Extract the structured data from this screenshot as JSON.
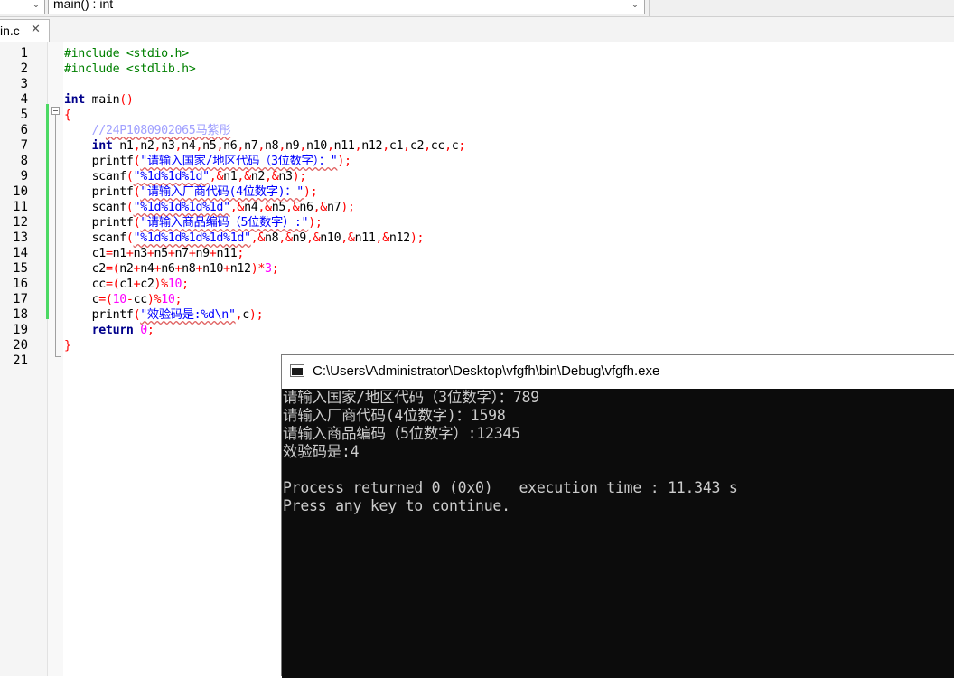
{
  "toolbar": {
    "scope_combo_value": "",
    "function_combo_value": "main() : int"
  },
  "tab": {
    "filename": "in.c",
    "close_glyph": "✕"
  },
  "editor": {
    "lines": [
      {
        "num": "1",
        "tokens": [
          {
            "t": "#include <stdio.h>",
            "c": "pre"
          }
        ]
      },
      {
        "num": "2",
        "tokens": [
          {
            "t": "#include <stdlib.h>",
            "c": "pre"
          }
        ]
      },
      {
        "num": "3",
        "tokens": []
      },
      {
        "num": "4",
        "tokens": [
          {
            "t": "int",
            "c": "kw"
          },
          {
            "t": " main",
            "c": ""
          },
          {
            "t": "()",
            "c": "pun"
          }
        ]
      },
      {
        "num": "5",
        "tokens": [
          {
            "t": "{",
            "c": "pun"
          }
        ]
      },
      {
        "num": "6",
        "tokens": [
          {
            "t": "    ",
            "c": ""
          },
          {
            "t": "//",
            "c": "cmt"
          },
          {
            "t": "24P1080902065马紫彤",
            "c": "cmt sq"
          }
        ]
      },
      {
        "num": "7",
        "tokens": [
          {
            "t": "    ",
            "c": ""
          },
          {
            "t": "int",
            "c": "kw"
          },
          {
            "t": " n1",
            "c": ""
          },
          {
            "t": ",",
            "c": "pun"
          },
          {
            "t": "n2",
            "c": ""
          },
          {
            "t": ",",
            "c": "pun"
          },
          {
            "t": "n3",
            "c": ""
          },
          {
            "t": ",",
            "c": "pun"
          },
          {
            "t": "n4",
            "c": ""
          },
          {
            "t": ",",
            "c": "pun"
          },
          {
            "t": "n5",
            "c": ""
          },
          {
            "t": ",",
            "c": "pun"
          },
          {
            "t": "n6",
            "c": ""
          },
          {
            "t": ",",
            "c": "pun"
          },
          {
            "t": "n7",
            "c": ""
          },
          {
            "t": ",",
            "c": "pun"
          },
          {
            "t": "n8",
            "c": ""
          },
          {
            "t": ",",
            "c": "pun"
          },
          {
            "t": "n9",
            "c": ""
          },
          {
            "t": ",",
            "c": "pun"
          },
          {
            "t": "n10",
            "c": ""
          },
          {
            "t": ",",
            "c": "pun"
          },
          {
            "t": "n11",
            "c": ""
          },
          {
            "t": ",",
            "c": "pun"
          },
          {
            "t": "n12",
            "c": ""
          },
          {
            "t": ",",
            "c": "pun"
          },
          {
            "t": "c1",
            "c": ""
          },
          {
            "t": ",",
            "c": "pun"
          },
          {
            "t": "c2",
            "c": ""
          },
          {
            "t": ",",
            "c": "pun"
          },
          {
            "t": "cc",
            "c": ""
          },
          {
            "t": ",",
            "c": "pun"
          },
          {
            "t": "c",
            "c": ""
          },
          {
            "t": ";",
            "c": "pun"
          }
        ]
      },
      {
        "num": "8",
        "tokens": [
          {
            "t": "    printf",
            "c": ""
          },
          {
            "t": "(",
            "c": "pun"
          },
          {
            "t": "\"请输入国家/地区代码（3位数字）：\"",
            "c": "str sq"
          },
          {
            "t": ");",
            "c": "pun"
          }
        ]
      },
      {
        "num": "9",
        "tokens": [
          {
            "t": "    scanf",
            "c": ""
          },
          {
            "t": "(",
            "c": "pun"
          },
          {
            "t": "\"%1d%1d%1d\"",
            "c": "str sq"
          },
          {
            "t": ",",
            "c": "pun"
          },
          {
            "t": "&",
            "c": "op"
          },
          {
            "t": "n1",
            "c": ""
          },
          {
            "t": ",",
            "c": "pun"
          },
          {
            "t": "&",
            "c": "op"
          },
          {
            "t": "n2",
            "c": ""
          },
          {
            "t": ",",
            "c": "pun"
          },
          {
            "t": "&",
            "c": "op"
          },
          {
            "t": "n3",
            "c": ""
          },
          {
            "t": ");",
            "c": "pun"
          }
        ]
      },
      {
        "num": "10",
        "tokens": [
          {
            "t": "    printf",
            "c": ""
          },
          {
            "t": "(",
            "c": "pun"
          },
          {
            "t": "\"请输入厂商代码(4位数字)：\"",
            "c": "str sq"
          },
          {
            "t": ");",
            "c": "pun"
          }
        ]
      },
      {
        "num": "11",
        "tokens": [
          {
            "t": "    scanf",
            "c": ""
          },
          {
            "t": "(",
            "c": "pun"
          },
          {
            "t": "\"%1d%1d%1d%1d\"",
            "c": "str sq"
          },
          {
            "t": ",",
            "c": "pun"
          },
          {
            "t": "&",
            "c": "op"
          },
          {
            "t": "n4",
            "c": ""
          },
          {
            "t": ",",
            "c": "pun"
          },
          {
            "t": "&",
            "c": "op"
          },
          {
            "t": "n5",
            "c": ""
          },
          {
            "t": ",",
            "c": "pun"
          },
          {
            "t": "&",
            "c": "op"
          },
          {
            "t": "n6",
            "c": ""
          },
          {
            "t": ",",
            "c": "pun"
          },
          {
            "t": "&",
            "c": "op"
          },
          {
            "t": "n7",
            "c": ""
          },
          {
            "t": ");",
            "c": "pun"
          }
        ]
      },
      {
        "num": "12",
        "tokens": [
          {
            "t": "    printf",
            "c": ""
          },
          {
            "t": "(",
            "c": "pun"
          },
          {
            "t": "\"请输入商品编码（5位数字）:\"",
            "c": "str sq"
          },
          {
            "t": ");",
            "c": "pun"
          }
        ]
      },
      {
        "num": "13",
        "tokens": [
          {
            "t": "    scanf",
            "c": ""
          },
          {
            "t": "(",
            "c": "pun"
          },
          {
            "t": "\"%1d%1d%1d%1d%1d\"",
            "c": "str sq"
          },
          {
            "t": ",",
            "c": "pun"
          },
          {
            "t": "&",
            "c": "op"
          },
          {
            "t": "n8",
            "c": ""
          },
          {
            "t": ",",
            "c": "pun"
          },
          {
            "t": "&",
            "c": "op"
          },
          {
            "t": "n9",
            "c": ""
          },
          {
            "t": ",",
            "c": "pun"
          },
          {
            "t": "&",
            "c": "op"
          },
          {
            "t": "n10",
            "c": ""
          },
          {
            "t": ",",
            "c": "pun"
          },
          {
            "t": "&",
            "c": "op"
          },
          {
            "t": "n11",
            "c": ""
          },
          {
            "t": ",",
            "c": "pun"
          },
          {
            "t": "&",
            "c": "op"
          },
          {
            "t": "n12",
            "c": ""
          },
          {
            "t": ");",
            "c": "pun"
          }
        ]
      },
      {
        "num": "14",
        "tokens": [
          {
            "t": "    c1",
            "c": ""
          },
          {
            "t": "=",
            "c": "op"
          },
          {
            "t": "n1",
            "c": ""
          },
          {
            "t": "+",
            "c": "op"
          },
          {
            "t": "n3",
            "c": ""
          },
          {
            "t": "+",
            "c": "op"
          },
          {
            "t": "n5",
            "c": ""
          },
          {
            "t": "+",
            "c": "op"
          },
          {
            "t": "n7",
            "c": ""
          },
          {
            "t": "+",
            "c": "op"
          },
          {
            "t": "n9",
            "c": ""
          },
          {
            "t": "+",
            "c": "op"
          },
          {
            "t": "n11",
            "c": ""
          },
          {
            "t": ";",
            "c": "pun"
          }
        ]
      },
      {
        "num": "15",
        "tokens": [
          {
            "t": "    c2",
            "c": ""
          },
          {
            "t": "=(",
            "c": "op"
          },
          {
            "t": "n2",
            "c": ""
          },
          {
            "t": "+",
            "c": "op"
          },
          {
            "t": "n4",
            "c": ""
          },
          {
            "t": "+",
            "c": "op"
          },
          {
            "t": "n6",
            "c": ""
          },
          {
            "t": "+",
            "c": "op"
          },
          {
            "t": "n8",
            "c": ""
          },
          {
            "t": "+",
            "c": "op"
          },
          {
            "t": "n10",
            "c": ""
          },
          {
            "t": "+",
            "c": "op"
          },
          {
            "t": "n12",
            "c": ""
          },
          {
            "t": ")*",
            "c": "op"
          },
          {
            "t": "3",
            "c": "num"
          },
          {
            "t": ";",
            "c": "pun"
          }
        ]
      },
      {
        "num": "16",
        "tokens": [
          {
            "t": "    cc",
            "c": ""
          },
          {
            "t": "=(",
            "c": "op"
          },
          {
            "t": "c1",
            "c": ""
          },
          {
            "t": "+",
            "c": "op"
          },
          {
            "t": "c2",
            "c": ""
          },
          {
            "t": ")%",
            "c": "op"
          },
          {
            "t": "10",
            "c": "num"
          },
          {
            "t": ";",
            "c": "pun"
          }
        ]
      },
      {
        "num": "17",
        "tokens": [
          {
            "t": "    c",
            "c": ""
          },
          {
            "t": "=(",
            "c": "op"
          },
          {
            "t": "10",
            "c": "num"
          },
          {
            "t": "-",
            "c": "op"
          },
          {
            "t": "cc",
            "c": ""
          },
          {
            "t": ")%",
            "c": "op"
          },
          {
            "t": "10",
            "c": "num"
          },
          {
            "t": ";",
            "c": "pun"
          }
        ]
      },
      {
        "num": "18",
        "tokens": [
          {
            "t": "    printf",
            "c": ""
          },
          {
            "t": "(",
            "c": "pun"
          },
          {
            "t": "\"效验码是:%d\\n\"",
            "c": "str sq"
          },
          {
            "t": ",",
            "c": "pun"
          },
          {
            "t": "c",
            "c": ""
          },
          {
            "t": ");",
            "c": "pun"
          }
        ]
      },
      {
        "num": "19",
        "tokens": [
          {
            "t": "    ",
            "c": ""
          },
          {
            "t": "return",
            "c": "kw"
          },
          {
            "t": " ",
            "c": ""
          },
          {
            "t": "0",
            "c": "num"
          },
          {
            "t": ";",
            "c": "pun"
          }
        ]
      },
      {
        "num": "20",
        "tokens": [
          {
            "t": "}",
            "c": "pun"
          }
        ]
      },
      {
        "num": "21",
        "tokens": []
      }
    ]
  },
  "console": {
    "title": "C:\\Users\\Administrator\\Desktop\\vfgfh\\bin\\Debug\\vfgfh.exe",
    "output": [
      "请输入国家/地区代码（3位数字）：789",
      "请输入厂商代码(4位数字)：1598",
      "请输入商品编码（5位数字）:12345",
      "效验码是:4",
      "",
      "Process returned 0 (0x0)   execution time : 11.343 s",
      "Press any key to continue."
    ]
  },
  "colors": {
    "preprocessor": "#008000",
    "keyword": "#00008b",
    "string": "#0000ff",
    "number": "#ff00ff",
    "operator": "#ff0000",
    "comment": "#a0a0ff",
    "change_bar": "#4cd964",
    "console_bg": "#0c0c0c",
    "console_text": "#cccccc"
  }
}
